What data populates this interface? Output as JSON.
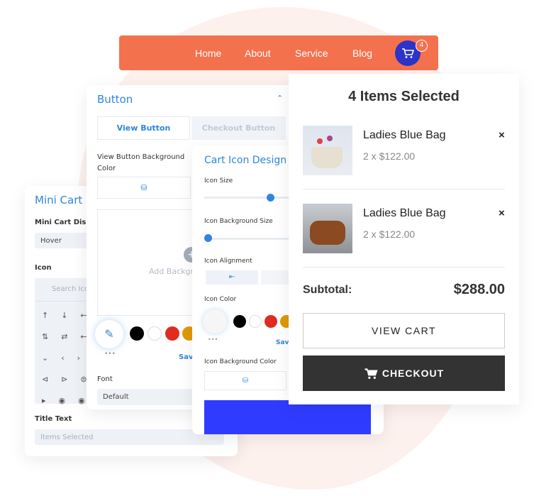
{
  "nav": {
    "items": [
      "Home",
      "About",
      "Service",
      "Blog"
    ],
    "cart_count": "4",
    "bg": "#f4714e",
    "cart_bg": "#2b33c8"
  },
  "mini_cart": {
    "title": "Mini Cart",
    "display_label": "Mini Cart Disp",
    "display_value": "Hover",
    "icon_label": "Icon",
    "search_placeholder": "Search Ico",
    "title_text_label": "Title Text",
    "title_text_value": "Items Selected"
  },
  "button_panel": {
    "title": "Button",
    "tabs": [
      "View Button",
      "Checkout Button"
    ],
    "bg_label": "View Button Background Color",
    "add_bg": "Add Backgr",
    "save": "Save",
    "font_label": "Font",
    "font_value": "Default"
  },
  "icon_panel": {
    "title": "Cart Icon Design",
    "icon_size": "Icon Size",
    "icon_bg_size": "Icon Background Size",
    "icon_alignment": "Icon Alignment",
    "icon_color": "Icon Color",
    "save": "Save",
    "icon_bg_color": "Icon Background Color",
    "icon_size_value": 0.82,
    "icon_bg_size_value": 0.0
  },
  "swatches": [
    "#000000",
    "#ffffff",
    "#e02b20",
    "#e09900"
  ],
  "cart": {
    "title": "4 Items Selected",
    "items": [
      {
        "name": "Ladies Blue Bag",
        "price": "2 x $122.00"
      },
      {
        "name": "Ladies Blue Bag",
        "price": "2 x $122.00"
      }
    ],
    "subtotal_label": "Subtotal:",
    "subtotal_value": "$288.00",
    "view_cart": "VIEW CART",
    "checkout": "CHECKOUT"
  }
}
